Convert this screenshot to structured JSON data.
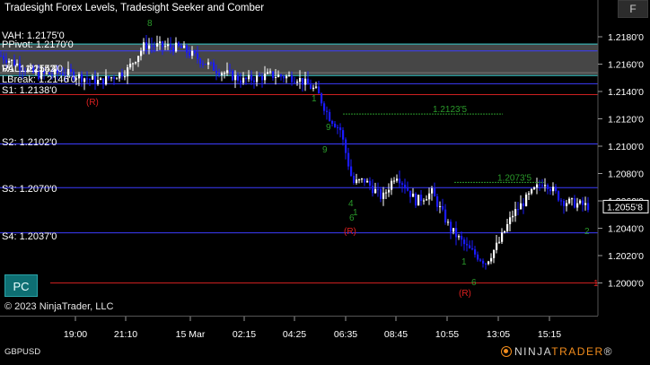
{
  "window": {
    "title": "Tradesight Forex Levels, Tradesight Seeker and Comber",
    "corner_button": "F"
  },
  "footer": {
    "copyright": "© 2023 NinjaTrader, LLC",
    "symbol": "GBPUSD",
    "logo_brand": "NINJA",
    "logo_trader": "TRADER",
    "logo_suffix": "®"
  },
  "pc_button": "PC",
  "colors": {
    "background": "#000000",
    "up_bar": "#ffffff",
    "down_bar": "#1a1aff",
    "level_line": "#3c3cff",
    "vah_line": "#35c8c8",
    "pivot_line": "#7a7a7a",
    "value_area": "#4a4a4a",
    "bottom_line": "#cc2020",
    "seeker_text": "#2a9a2a",
    "signal_red": "#e02020"
  },
  "chart_data": {
    "type": "candlestick",
    "instrument": "GBPUSD",
    "y_axis": {
      "min": 1.1991,
      "max": 1.219,
      "tick_labels": [
        "1.2180'0",
        "1.2160'0",
        "1.2140'0",
        "1.2120'0",
        "1.2100'0",
        "1.2080'0",
        "1.2060'0",
        "1.2040'0",
        "1.2020'0",
        "1.2000'0"
      ],
      "tick_values": [
        1.218,
        1.216,
        1.214,
        1.212,
        1.21,
        1.208,
        1.206,
        1.204,
        1.202,
        1.2
      ]
    },
    "x_axis": {
      "tick_labels": [
        "19:00",
        "21:10",
        "15 Mar",
        "02:15",
        "04:25",
        "06:35",
        "08:45",
        "10:55",
        "13:05",
        "15:15"
      ]
    },
    "current_price": {
      "label": "1.2055'8",
      "value": 1.20558
    },
    "levels": [
      {
        "label": "VAH: 1.2175'0",
        "value": 1.2175
      },
      {
        "label": "PPivot: 1.2170'0",
        "value": 1.217
      },
      {
        "label": "R1: 1.2154'0",
        "value": 1.2154
      },
      {
        "label": "VAL: 1.2152'0",
        "value": 1.2152
      },
      {
        "label": "LBreak: 1.2146'0",
        "value": 1.2146
      },
      {
        "label": "S1: 1.2138'0",
        "value": 1.2138
      },
      {
        "label": "S2: 1.2102'0",
        "value": 1.2102
      },
      {
        "label": "S3: 1.2070'0",
        "value": 1.207
      },
      {
        "label": "S4: 1.2037'0",
        "value": 1.2037
      }
    ],
    "seeker_levels": [
      {
        "label": "1.2123'5",
        "value": 1.21235
      },
      {
        "label": "1.2073'5",
        "value": 1.20735
      }
    ],
    "signals": [
      {
        "label": "(R)",
        "near": "S1"
      },
      {
        "label": "(R)",
        "near": "S4"
      },
      {
        "label": "(R)",
        "near": "low"
      }
    ],
    "counters": [
      "8",
      "9",
      "1",
      "9",
      "6",
      "4",
      "1",
      "2",
      "6",
      "1"
    ],
    "bottom_line_marker": "1"
  }
}
